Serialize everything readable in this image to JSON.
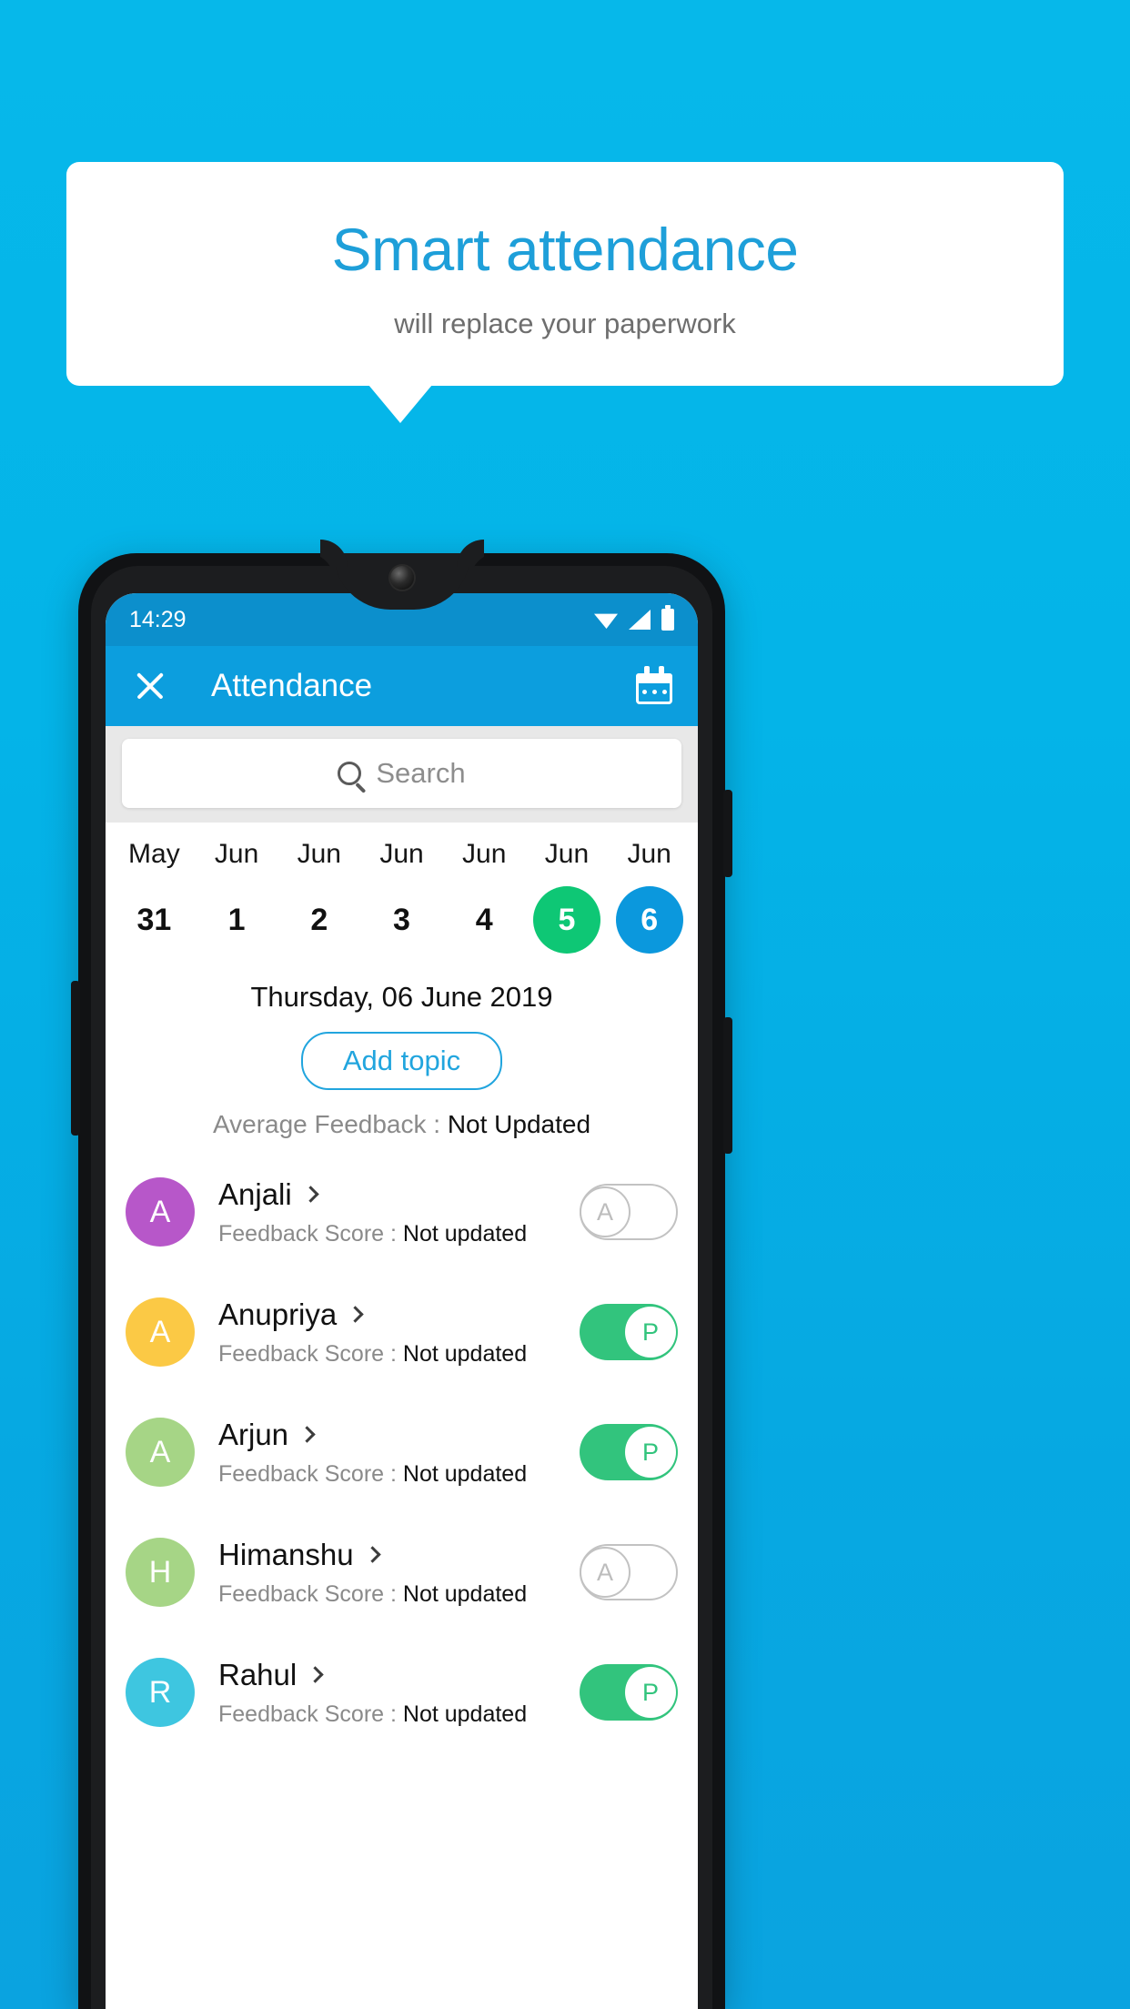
{
  "promo": {
    "headline": "Smart attendance",
    "subhead": "will replace your paperwork",
    "bg_color": "#06b4e8",
    "headline_color": "#1e9fd9"
  },
  "phone": {
    "status_bar": {
      "time": "14:29",
      "icons": [
        "wifi-icon",
        "signal-icon",
        "battery-icon"
      ]
    },
    "app_bar": {
      "close_icon": "close-icon",
      "title": "Attendance",
      "calendar_icon": "calendar-icon",
      "bg_color": "#0c9ede"
    },
    "search": {
      "icon": "search-icon",
      "placeholder": "Search",
      "value": ""
    },
    "date_strip": [
      {
        "month": "May",
        "day": "31",
        "state": "none"
      },
      {
        "month": "Jun",
        "day": "1",
        "state": "none"
      },
      {
        "month": "Jun",
        "day": "2",
        "state": "none"
      },
      {
        "month": "Jun",
        "day": "3",
        "state": "none"
      },
      {
        "month": "Jun",
        "day": "4",
        "state": "none"
      },
      {
        "month": "Jun",
        "day": "5",
        "state": "green"
      },
      {
        "month": "Jun",
        "day": "6",
        "state": "blue"
      }
    ],
    "day_header": "Thursday, 06 June 2019",
    "add_topic_label": "Add topic",
    "average_feedback": {
      "label": "Average Feedback : ",
      "value": "Not Updated"
    },
    "students": [
      {
        "name": "Anjali",
        "initial": "A",
        "avatar_color": "#b757c9",
        "feedback_label": "Feedback Score : ",
        "feedback_value": "Not updated",
        "attendance": "A",
        "attendance_state": "absent"
      },
      {
        "name": "Anupriya",
        "initial": "A",
        "avatar_color": "#fbc945",
        "feedback_label": "Feedback Score : ",
        "feedback_value": "Not updated",
        "attendance": "P",
        "attendance_state": "present"
      },
      {
        "name": "Arjun",
        "initial": "A",
        "avatar_color": "#a6d586",
        "feedback_label": "Feedback Score : ",
        "feedback_value": "Not updated",
        "attendance": "P",
        "attendance_state": "present"
      },
      {
        "name": "Himanshu",
        "initial": "H",
        "avatar_color": "#a6d586",
        "feedback_label": "Feedback Score : ",
        "feedback_value": "Not updated",
        "attendance": "A",
        "attendance_state": "absent"
      },
      {
        "name": "Rahul",
        "initial": "R",
        "avatar_color": "#3ec6e0",
        "feedback_label": "Feedback Score : ",
        "feedback_value": "Not updated",
        "attendance": "P",
        "attendance_state": "present"
      }
    ],
    "colors": {
      "present_green": "#32c47d",
      "selected_green": "#0ec775",
      "selected_blue": "#0b98dd",
      "accent_blue": "#21a5de"
    }
  }
}
